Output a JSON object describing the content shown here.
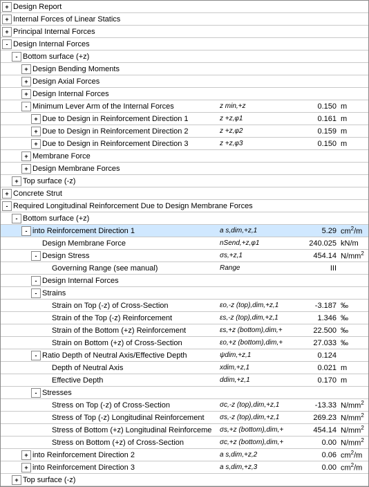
{
  "colors": {
    "border": "#888888",
    "highlight": "#d0e8ff",
    "normal_bg": "#ffffff"
  },
  "rows": [
    {
      "id": 1,
      "indent": 0,
      "expand": "+",
      "label": "Design Report",
      "symbol": "",
      "value": "",
      "unit": "",
      "bold": false
    },
    {
      "id": 2,
      "indent": 0,
      "expand": "+",
      "label": "Internal Forces of Linear Statics",
      "symbol": "",
      "value": "",
      "unit": "",
      "bold": false
    },
    {
      "id": 3,
      "indent": 0,
      "expand": "+",
      "label": "Principal Internal Forces",
      "symbol": "",
      "value": "",
      "unit": "",
      "bold": false
    },
    {
      "id": 4,
      "indent": 0,
      "expand": "-",
      "label": "Design Internal Forces",
      "symbol": "",
      "value": "",
      "unit": "",
      "bold": false
    },
    {
      "id": 5,
      "indent": 1,
      "expand": "-",
      "label": "Bottom surface (+z)",
      "symbol": "",
      "value": "",
      "unit": "",
      "bold": false
    },
    {
      "id": 6,
      "indent": 2,
      "expand": "+",
      "label": "Design Bending Moments",
      "symbol": "",
      "value": "",
      "unit": "",
      "bold": false
    },
    {
      "id": 7,
      "indent": 2,
      "expand": "+",
      "label": "Design Axial Forces",
      "symbol": "",
      "value": "",
      "unit": "",
      "bold": false
    },
    {
      "id": 8,
      "indent": 2,
      "expand": "+",
      "label": "Design Internal Forces",
      "symbol": "",
      "value": "",
      "unit": "",
      "bold": false
    },
    {
      "id": 9,
      "indent": 2,
      "expand": "-",
      "label": "Minimum Lever Arm of the Internal Forces",
      "symbol": "z min,+z",
      "value": "0.150",
      "unit": "m",
      "bold": false
    },
    {
      "id": 10,
      "indent": 3,
      "expand": "+",
      "label": "Due to Design in Reinforcement Direction 1",
      "symbol": "z +z,φ1",
      "value": "0.161",
      "unit": "m",
      "bold": false
    },
    {
      "id": 11,
      "indent": 3,
      "expand": "+",
      "label": "Due to Design in Reinforcement Direction 2",
      "symbol": "z +z,φ2",
      "value": "0.159",
      "unit": "m",
      "bold": false
    },
    {
      "id": 12,
      "indent": 3,
      "expand": "+",
      "label": "Due to Design in Reinforcement Direction 3",
      "symbol": "z +z,φ3",
      "value": "0.150",
      "unit": "m",
      "bold": false
    },
    {
      "id": 13,
      "indent": 2,
      "expand": "+",
      "label": "Membrane Force",
      "symbol": "",
      "value": "",
      "unit": "",
      "bold": false
    },
    {
      "id": 14,
      "indent": 2,
      "expand": "+",
      "label": "Design Membrane Forces",
      "symbol": "",
      "value": "",
      "unit": "",
      "bold": false
    },
    {
      "id": 15,
      "indent": 1,
      "expand": "+",
      "label": "Top surface (-z)",
      "symbol": "",
      "value": "",
      "unit": "",
      "bold": false
    },
    {
      "id": 16,
      "indent": 0,
      "expand": "+",
      "label": "Concrete Strut",
      "symbol": "",
      "value": "",
      "unit": "",
      "bold": false
    },
    {
      "id": 17,
      "indent": 0,
      "expand": "-",
      "label": "Required Longitudinal Reinforcement Due to Design Membrane Forces",
      "symbol": "",
      "value": "",
      "unit": "",
      "bold": false
    },
    {
      "id": 18,
      "indent": 1,
      "expand": "-",
      "label": "Bottom surface (+z)",
      "symbol": "",
      "value": "",
      "unit": "",
      "bold": false
    },
    {
      "id": 19,
      "indent": 2,
      "expand": "-",
      "label": "into Reinforcement Direction 1",
      "symbol": "a s,dim,+z,1",
      "value": "5.29",
      "unit": "cm²/m",
      "bold": false,
      "highlight": true
    },
    {
      "id": 20,
      "indent": 3,
      "expand": null,
      "label": "Design Membrane Force",
      "symbol": "nSend,+z,φ1",
      "value": "240.025",
      "unit": "kN/m",
      "bold": false
    },
    {
      "id": 21,
      "indent": 3,
      "expand": "-",
      "label": "Design Stress",
      "symbol": "σs,+z,1",
      "value": "454.14",
      "unit": "N/mm²",
      "bold": false
    },
    {
      "id": 22,
      "indent": 4,
      "expand": null,
      "label": "Governing Range (see manual)",
      "symbol": "Range",
      "value": "III",
      "unit": "",
      "bold": false
    },
    {
      "id": 23,
      "indent": 3,
      "expand": "-",
      "label": "Design Internal Forces",
      "symbol": "",
      "value": "",
      "unit": "",
      "bold": false
    },
    {
      "id": 24,
      "indent": 3,
      "expand": "-",
      "label": "Strains",
      "symbol": "",
      "value": "",
      "unit": "",
      "bold": false
    },
    {
      "id": 25,
      "indent": 4,
      "expand": null,
      "label": "Strain on Top (-z) of Cross-Section",
      "symbol": "εo,-z (top),dim,+z,1",
      "value": "-3.187",
      "unit": "‰",
      "bold": false
    },
    {
      "id": 26,
      "indent": 4,
      "expand": null,
      "label": "Strain of the Top (-z) Reinforcement",
      "symbol": "εs,-z (top),dim,+z,1",
      "value": "1.346",
      "unit": "‰",
      "bold": false
    },
    {
      "id": 27,
      "indent": 4,
      "expand": null,
      "label": "Strain of the Bottom (+z) Reinforcement",
      "symbol": "εs,+z (bottom),dim,+",
      "value": "22.500",
      "unit": "‰",
      "bold": false
    },
    {
      "id": 28,
      "indent": 4,
      "expand": null,
      "label": "Strain on Bottom (+z) of Cross-Section",
      "symbol": "εo,+z (bottom),dim,+",
      "value": "27.033",
      "unit": "‰",
      "bold": false
    },
    {
      "id": 29,
      "indent": 3,
      "expand": "-",
      "label": "Ratio Depth of Neutral Axis/Effective Depth",
      "symbol": "ψdim,+z,1",
      "value": "0.124",
      "unit": "",
      "bold": false
    },
    {
      "id": 30,
      "indent": 4,
      "expand": null,
      "label": "Depth of Neutral Axis",
      "symbol": "xdim,+z,1",
      "value": "0.021",
      "unit": "m",
      "bold": false
    },
    {
      "id": 31,
      "indent": 4,
      "expand": null,
      "label": "Effective Depth",
      "symbol": "ddim,+z,1",
      "value": "0.170",
      "unit": "m",
      "bold": false
    },
    {
      "id": 32,
      "indent": 3,
      "expand": "-",
      "label": "Stresses",
      "symbol": "",
      "value": "",
      "unit": "",
      "bold": false
    },
    {
      "id": 33,
      "indent": 4,
      "expand": null,
      "label": "Stress on Top (-z) of Cross-Section",
      "symbol": "σc,-z (top),dim,+z,1",
      "value": "-13.33",
      "unit": "N/mm²",
      "bold": false
    },
    {
      "id": 34,
      "indent": 4,
      "expand": null,
      "label": "Stress of Top (-z) Longitudinal Reinforcement",
      "symbol": "σs,-z (top),dim,+z,1",
      "value": "269.23",
      "unit": "N/mm²",
      "bold": false
    },
    {
      "id": 35,
      "indent": 4,
      "expand": null,
      "label": "Stress of Bottom (+z) Longitudinal Reinforceme",
      "symbol": "σs,+z (bottom),dim,+",
      "value": "454.14",
      "unit": "N/mm²",
      "bold": false
    },
    {
      "id": 36,
      "indent": 4,
      "expand": null,
      "label": "Stress on Bottom (+z) of Cross-Section",
      "symbol": "σc,+z (bottom),dim,+",
      "value": "0.00",
      "unit": "N/mm²",
      "bold": false
    },
    {
      "id": 37,
      "indent": 2,
      "expand": "+",
      "label": "into Reinforcement Direction 2",
      "symbol": "a s,dim,+z,2",
      "value": "0.06",
      "unit": "cm²/m",
      "bold": false
    },
    {
      "id": 38,
      "indent": 2,
      "expand": "+",
      "label": "into Reinforcement Direction 3",
      "symbol": "a s,dim,+z,3",
      "value": "0.00",
      "unit": "cm²/m",
      "bold": false
    },
    {
      "id": 39,
      "indent": 1,
      "expand": "+",
      "label": "Top surface (-z)",
      "symbol": "",
      "value": "",
      "unit": "",
      "bold": false
    }
  ]
}
